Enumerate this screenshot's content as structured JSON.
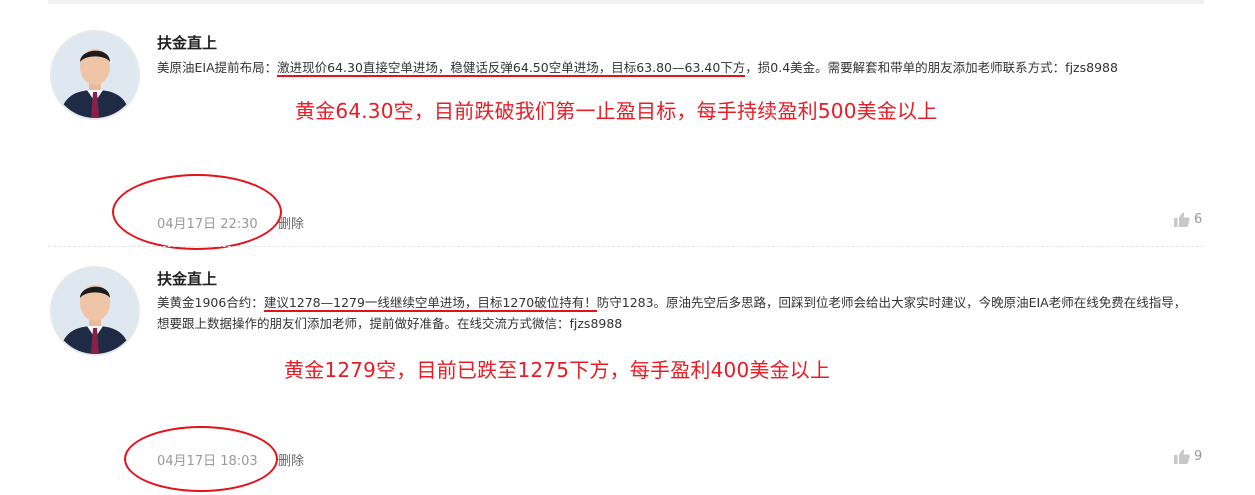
{
  "posts": [
    {
      "author": "扶金直上",
      "content_prefix": "美原油EIA提前布局：",
      "content_underlined": "激进现价64.30直接空单进场，稳健话反弹64.50空单进场，目标63.80—63.40下方",
      "content_suffix": "，损0.4美金。需要解套和带单的朋友添加老师联系方式：fjzs8988",
      "annotation": "黄金64.30空，目前跌破我们第一止盈目标，每手持续盈利500美金以上",
      "timestamp": "04月17日 22:30",
      "delete_label": "删除",
      "likes": "6"
    },
    {
      "author": "扶金直上",
      "content_prefix": "美黄金1906合约：",
      "content_underlined": "建议1278—1279一线继续空单进场，目标1270破位持有！",
      "content_suffix": "防守1283。原油先空后多思路，回踩到位老师会给出大家实时建议，今晚原油EIA老师在线免费在线指导，想要跟上数据操作的朋友们添加老师，提前做好准备。在线交流方式微信：fjzs8988",
      "annotation": "黄金1279空，目前已跌至1275下方，每手盈利400美金以上",
      "timestamp": "04月17日 18:03",
      "delete_label": "删除",
      "likes": "9"
    }
  ],
  "colors": {
    "annotation": "#e81c25",
    "underline": "#e8101a",
    "meta": "#999999"
  },
  "icons": {
    "like": "thumbs-up-icon",
    "avatar": "avatar-photo"
  }
}
